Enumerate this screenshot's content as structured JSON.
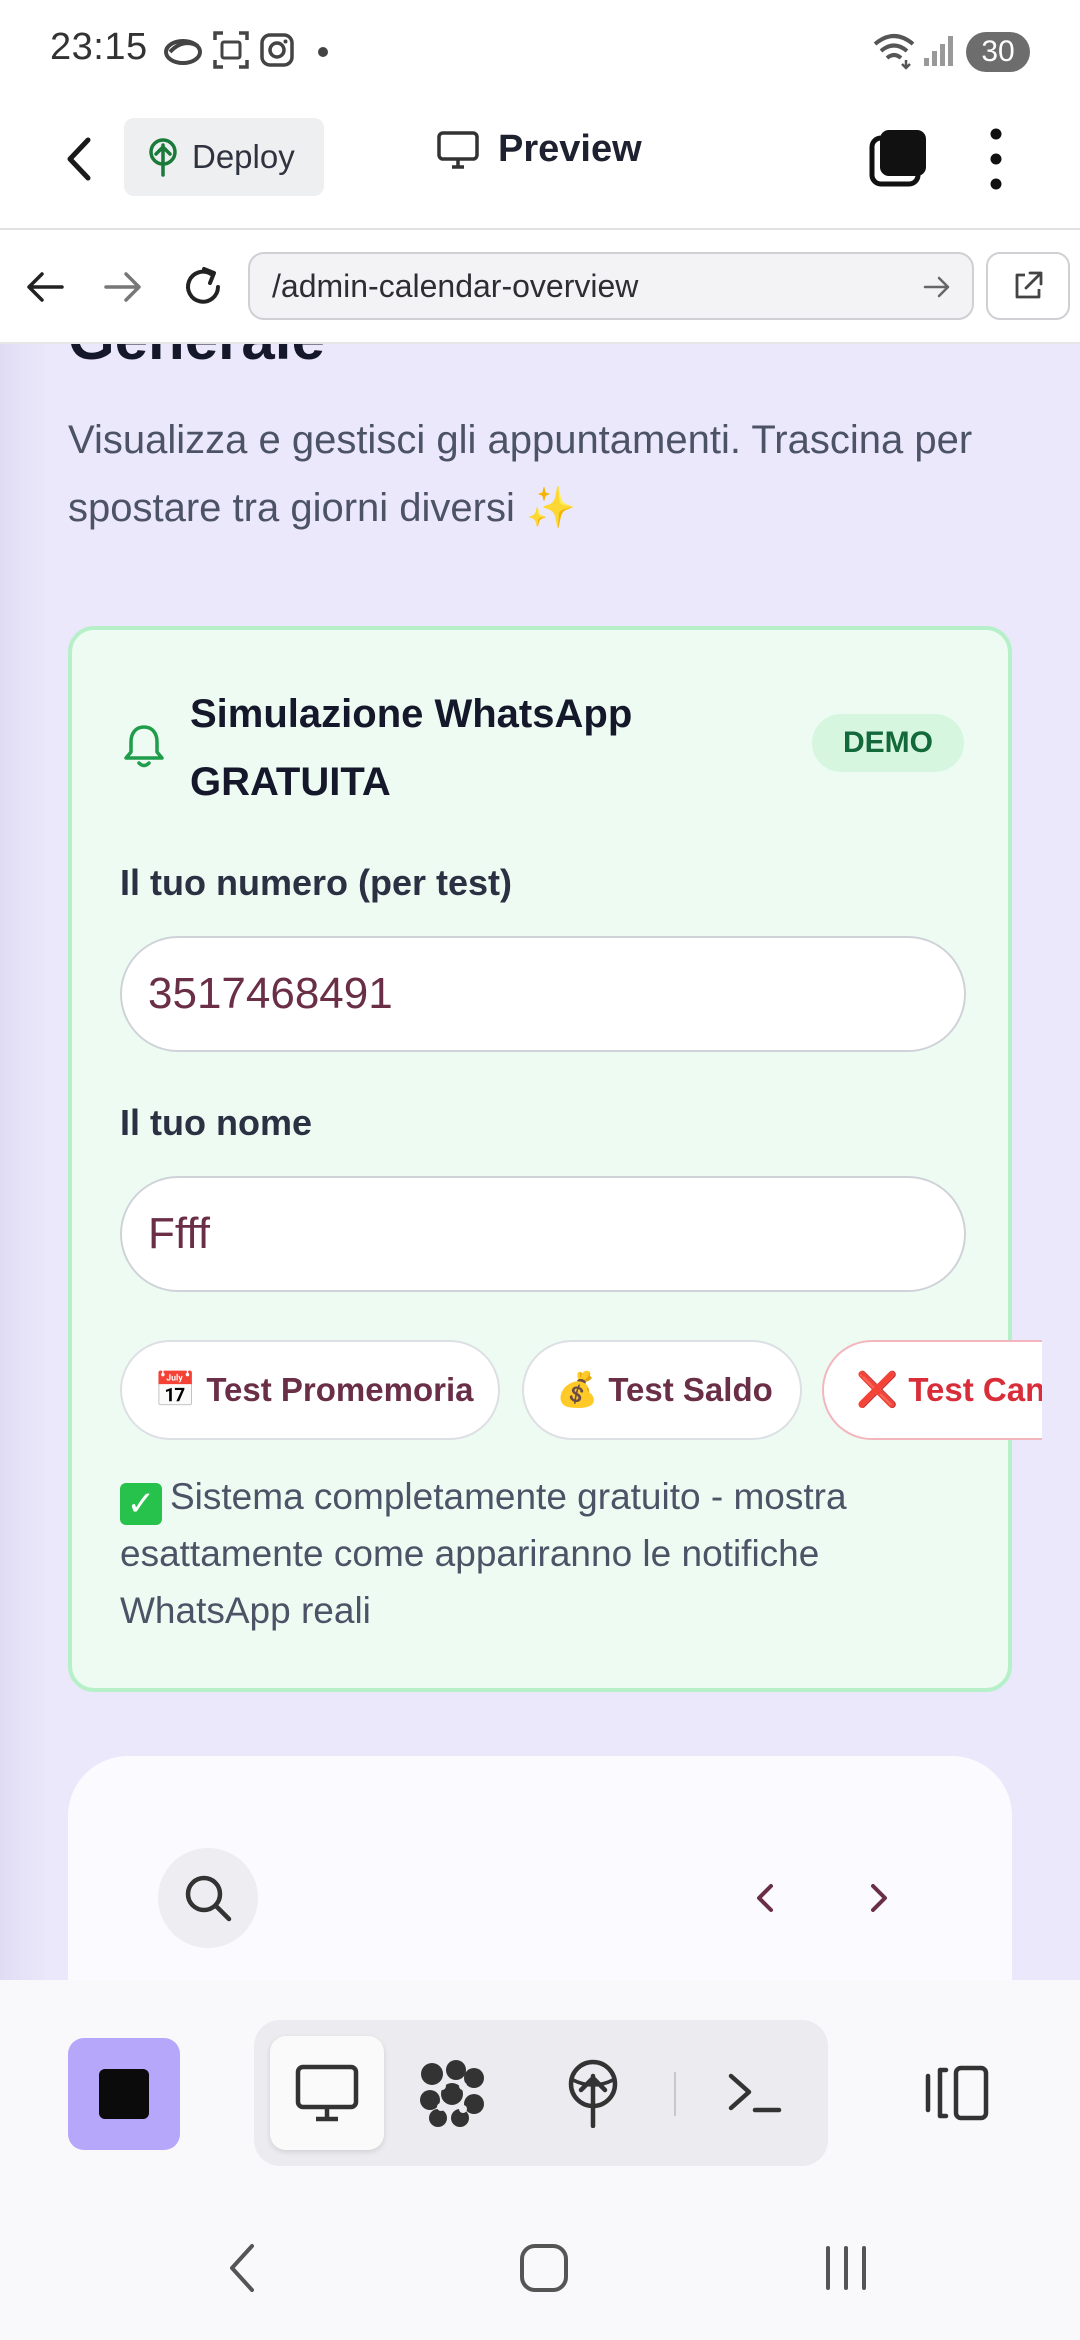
{
  "status_bar": {
    "time": "23:15",
    "battery": "30",
    "icons": [
      "cloud-icon",
      "screenshot-icon",
      "instagram-icon",
      "dot-icon",
      "wifi-icon",
      "signal-icon",
      "battery-icon"
    ]
  },
  "header": {
    "deploy_label": "Deploy",
    "preview_label": "Preview"
  },
  "browser": {
    "url": "/admin-calendar-overview"
  },
  "page": {
    "heading": "Generale",
    "subtitle": "Visualizza e gestisci gli appuntamenti. Trascina per spostare tra giorni diversi ✨"
  },
  "whatsapp_card": {
    "title": "Simulazione WhatsApp GRATUITA",
    "badge": "DEMO",
    "phone_label": "Il tuo numero (per test)",
    "phone_value": "3517468491",
    "name_label": "Il tuo nome",
    "name_value": "Ffff",
    "buttons": [
      {
        "emoji": "📅",
        "label": "Test Promemoria"
      },
      {
        "emoji": "💰",
        "label": "Test Saldo"
      },
      {
        "emoji": "❌",
        "label": "Test Cancel"
      }
    ],
    "note_check": "✓",
    "note": "Sistema completamente gratuito - mostra esattamente come appariranno le notifiche WhatsApp reali"
  },
  "colors": {
    "accent_purple": "#b7a7fb",
    "card_green_bg": "#eefbf2",
    "card_green_border": "#b6f0c8",
    "badge_green": "#13693a",
    "button_text": "#6a2f47",
    "cancel_red": "#d92d3a",
    "page_bg": "#ece8fb"
  }
}
